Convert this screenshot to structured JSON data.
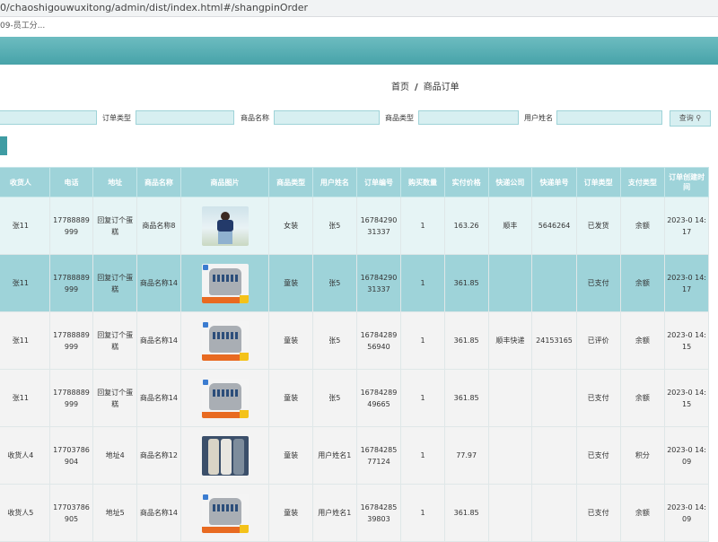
{
  "browser": {
    "url": "0/chaoshigouwuxitong/admin/dist/index.html#/shangpinOrder",
    "tab_text": "09-员工分..."
  },
  "breadcrumb": {
    "home": "首页",
    "separator": "/",
    "current": "商品订单"
  },
  "search": {
    "order_type_label": "订单类型",
    "product_name_label": "商品名称",
    "product_type_label": "商品类型",
    "user_name_label": "用户姓名",
    "query_button": "查询",
    "search_icon": "search-icon"
  },
  "colors": {
    "accent": "#47a3a9",
    "header": "#9ed3d9",
    "row_highlight": "#9ed3d9"
  },
  "table": {
    "columns": [
      "收货人",
      "电话",
      "地址",
      "商品名称",
      "商品图片",
      "商品类型",
      "用户姓名",
      "订单编号",
      "购买数量",
      "实付价格",
      "快递公司",
      "快递单号",
      "订单类型",
      "支付类型",
      "订单创建时间"
    ],
    "rows": [
      {
        "receiver": "张11",
        "phone": "17788889999",
        "address": "回复订个蛋糕",
        "product": "商品名称8",
        "image": "woman-outfit",
        "type": "女装",
        "user": "张5",
        "order_no": "1678429031337",
        "qty": "1",
        "price": "163.26",
        "courier": "顺丰",
        "tracking": "5646264",
        "order_type": "已发货",
        "pay_type": "余额",
        "created": "2023-0 14:17"
      },
      {
        "receiver": "张11",
        "phone": "17788889999",
        "address": "回复订个蛋糕",
        "product": "商品名称14",
        "image": "kids-sweatshirt",
        "type": "童装",
        "user": "张5",
        "order_no": "1678429031337",
        "qty": "1",
        "price": "361.85",
        "courier": "",
        "tracking": "",
        "order_type": "已支付",
        "pay_type": "余额",
        "created": "2023-0 14:17"
      },
      {
        "receiver": "张11",
        "phone": "17788889999",
        "address": "回复订个蛋糕",
        "product": "商品名称14",
        "image": "kids-sweatshirt",
        "type": "童装",
        "user": "张5",
        "order_no": "1678428956940",
        "qty": "1",
        "price": "361.85",
        "courier": "顺丰快递",
        "tracking": "24153165",
        "order_type": "已评价",
        "pay_type": "余额",
        "created": "2023-0 14:15"
      },
      {
        "receiver": "张11",
        "phone": "17788889999",
        "address": "回复订个蛋糕",
        "product": "商品名称14",
        "image": "kids-sweatshirt",
        "type": "童装",
        "user": "张5",
        "order_no": "1678428949665",
        "qty": "1",
        "price": "361.85",
        "courier": "",
        "tracking": "",
        "order_type": "已支付",
        "pay_type": "余额",
        "created": "2023-0 14:15"
      },
      {
        "receiver": "收货人4",
        "phone": "17703786904",
        "address": "地址4",
        "product": "商品名称12",
        "image": "kids-pants",
        "type": "童装",
        "user": "用户姓名1",
        "order_no": "1678428577124",
        "qty": "1",
        "price": "77.97",
        "courier": "",
        "tracking": "",
        "order_type": "已支付",
        "pay_type": "积分",
        "created": "2023-0 14:09"
      },
      {
        "receiver": "收货人5",
        "phone": "17703786905",
        "address": "地址5",
        "product": "商品名称14",
        "image": "kids-sweatshirt",
        "type": "童装",
        "user": "用户姓名1",
        "order_no": "1678428539803",
        "qty": "1",
        "price": "361.85",
        "courier": "",
        "tracking": "",
        "order_type": "已支付",
        "pay_type": "余额",
        "created": "2023-0 14:09"
      }
    ]
  }
}
